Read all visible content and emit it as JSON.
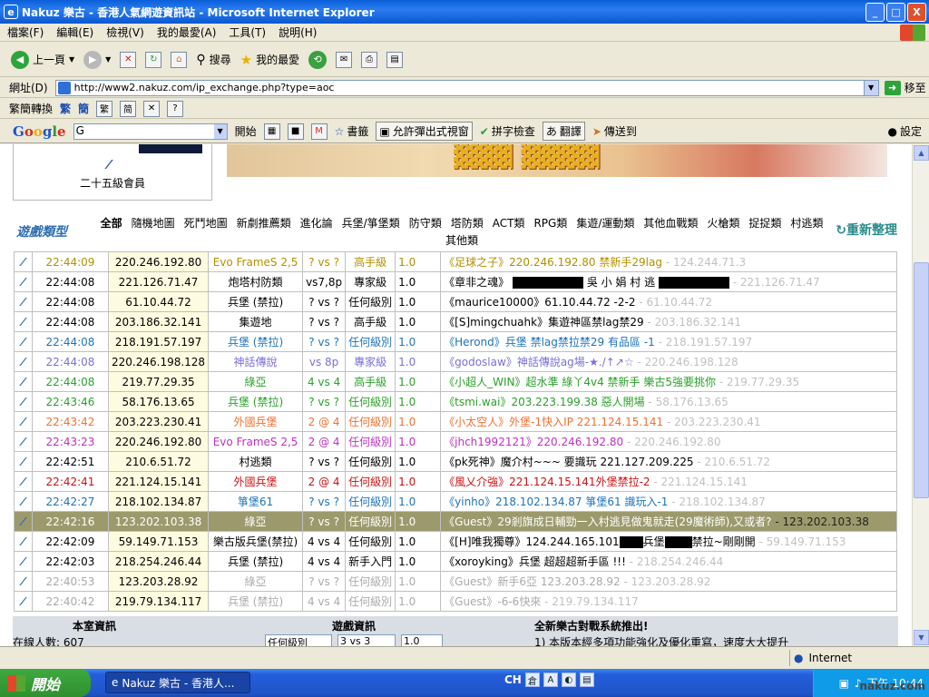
{
  "window": {
    "title": "Nakuz 樂古 - 香港人氣網遊資訊站 - Microsoft Internet Explorer",
    "buttons": [
      "_",
      "□",
      "X"
    ]
  },
  "menu": [
    "檔案(F)",
    "編輯(E)",
    "檢視(V)",
    "我的最愛(A)",
    "工具(T)",
    "說明(H)"
  ],
  "toolbar": {
    "back": "上一頁",
    "search": "搜尋",
    "favorites": "我的最愛"
  },
  "address": {
    "label": "網址(D)",
    "url": "http://www2.nakuz.com/ip_exchange.php?type=aoc",
    "go": "移至"
  },
  "convbar": {
    "label": "繁簡轉換",
    "trad": "繁",
    "simp": "簡"
  },
  "googlebar": {
    "logo": [
      "G",
      "o",
      "o",
      "g",
      "l",
      "e"
    ],
    "query": "G",
    "start": "開始",
    "bookmarks": "書籤",
    "popup": "允許彈出式視窗",
    "spell": "拼字檢查",
    "translate": "翻譯",
    "send": "傳送到",
    "settings": "設定"
  },
  "member": {
    "name": "二十五級會員"
  },
  "categories": {
    "label": "遊戲類型",
    "links": [
      "全部",
      "隨機地圖",
      "死鬥地圖",
      "新劇推薦類",
      "進化論",
      "兵堡/箏堡類",
      "防守類",
      "塔防類",
      "ACT類",
      "RPG類",
      "集遊/運動類",
      "其他血戰類",
      "火槍類",
      "捉捉類",
      "村逃類",
      "其他類"
    ],
    "reset": "重新整理"
  },
  "rows": [
    {
      "time": "22:44:09",
      "ip": "220.246.192.80",
      "game": "Evo FrameS 2,5",
      "mode": "? vs ?",
      "level": "高手級",
      "ver": "1.0",
      "msg": "《足球之子》220.246.192.80 禁新手29lag",
      "ipx": "- 124.244.71.3",
      "color": "#b09000",
      "style": "normal"
    },
    {
      "time": "22:44:08",
      "ip": "221.126.71.47",
      "game": "炮塔村防類",
      "mode": "vs7,8p",
      "level": "專家級",
      "ver": "1.0",
      "msg": "《章非之魂》",
      "msg2": "吳 小 娟 村 逃",
      "ipx": "- 221.126.71.47",
      "color": "#000000",
      "style": "blk"
    },
    {
      "time": "22:44:08",
      "ip": "61.10.44.72",
      "game": "兵堡 (禁拉)",
      "mode": "? vs ?",
      "level": "任何級別",
      "ver": "1.0",
      "msg": "《maurice10000》61.10.44.72 -2-2",
      "ipx": "- 61.10.44.72",
      "color": "#000000",
      "style": "normal"
    },
    {
      "time": "22:44:08",
      "ip": "203.186.32.141",
      "game": "集遊地",
      "mode": "? vs ?",
      "level": "高手級",
      "ver": "1.0",
      "msg": "《[S]mingchuahk》集遊神區禁lag禁29",
      "ipx": "- 203.186.32.141",
      "color": "#000000",
      "style": "normal"
    },
    {
      "time": "22:44:08",
      "ip": "218.191.57.197",
      "game": "兵堡 (禁拉)",
      "mode": "? vs ?",
      "level": "任何級別",
      "ver": "1.0",
      "msg": "《Herond》兵堡 禁lag禁拉禁29 有品區 -1",
      "ipx": "- 218.191.57.197",
      "color": "#1e72b8",
      "style": "normal"
    },
    {
      "time": "22:44:08",
      "ip": "220.246.198.128",
      "game": "神話傳說",
      "mode": "vs 8p",
      "level": "專家級",
      "ver": "1.0",
      "msg": "《godoslaw》神話傳說ag場-★./↑↗☆",
      "ipx": "- 220.246.198.128",
      "color": "#7a70d8",
      "style": "normal"
    },
    {
      "time": "22:44:08",
      "ip": "219.77.29.35",
      "game": "綠亞",
      "mode": "4 vs 4",
      "level": "高手級",
      "ver": "1.0",
      "msg": "《小超人_WIN》超水準 綠丫4v4 禁新手 樂古5強要挑你",
      "ipx": "- 219.77.29.35",
      "color": "#2aa02a",
      "style": "normal"
    },
    {
      "time": "22:43:46",
      "ip": "58.176.13.65",
      "game": "兵堡 (禁拉)",
      "mode": "? vs ?",
      "level": "任何級別",
      "ver": "1.0",
      "msg": "《tsmi.wai》203.223.199.38 惡人開場",
      "ipx": "- 58.176.13.65",
      "color": "#2aa02a",
      "style": "normal"
    },
    {
      "time": "22:43:42",
      "ip": "203.223.230.41",
      "game": "外國兵堡",
      "mode": "2 @ 4",
      "level": "任何級別",
      "ver": "1.0",
      "msg": "《小太空人》外堡-1快入IP 221.124.15.141",
      "ipx": "- 203.223.230.41",
      "color": "#f07030",
      "style": "normal"
    },
    {
      "time": "22:43:23",
      "ip": "220.246.192.80",
      "game": "Evo FrameS 2,5",
      "mode": "2 @ 4",
      "level": "任何級別",
      "ver": "1.0",
      "msg": "《jhch1992121》220.246.192.80",
      "ipx": "- 220.246.192.80",
      "color": "#c030c0",
      "style": "normal"
    },
    {
      "time": "22:42:51",
      "ip": "210.6.51.72",
      "game": "村逃類",
      "mode": "? vs ?",
      "level": "任何級別",
      "ver": "1.0",
      "msg": "《pk死神》魔介村~~~ 要識玩 221.127.209.225",
      "ipx": "- 210.6.51.72",
      "color": "#000000",
      "style": "normal"
    },
    {
      "time": "22:42:41",
      "ip": "221.124.15.141",
      "game": "外國兵堡",
      "mode": "2 @ 4",
      "level": "任何級別",
      "ver": "1.0",
      "msg": "《風乂介強》221.124.15.141外堡禁拉-2",
      "ipx": "- 221.124.15.141",
      "color": "#d01010",
      "style": "normal"
    },
    {
      "time": "22:42:27",
      "ip": "218.102.134.87",
      "game": "箏堡61",
      "mode": "? vs ?",
      "level": "任何級別",
      "ver": "1.0",
      "msg": "《yinho》218.102.134.87 箏堡61 識玩入-1",
      "ipx": "- 218.102.134.87",
      "color": "#1e72b8",
      "style": "normal"
    },
    {
      "time": "22:42:16",
      "ip": "123.202.103.38",
      "game": "綠亞",
      "mode": "? vs ?",
      "level": "任何級別",
      "ver": "1.0",
      "msg": "《Guest》29剎旗成日輔勁一入村逃見做鬼就走(29魔術師),又或者?",
      "ipx": "- 123.202.103.38",
      "color": "#ffffff",
      "style": "sel"
    },
    {
      "time": "22:42:09",
      "ip": "59.149.71.153",
      "game": "樂古版兵堡(禁拉)",
      "mode": "4 vs 4",
      "level": "任何級別",
      "ver": "1.0",
      "msg": "《[H]唯我獨尊》124.244.165.101",
      "msg2": "兵堡",
      "msg3": "禁拉~剛剛開",
      "ipx": "- 59.149.71.153",
      "color": "#000000",
      "style": "blk2"
    },
    {
      "time": "22:42:03",
      "ip": "218.254.246.44",
      "game": "兵堡 (禁拉)",
      "mode": "4 vs 4",
      "level": "新手入門",
      "ver": "1.0",
      "msg": "《xoroyking》兵堡 超超超新手區 !!!",
      "ipx": "- 218.254.246.44",
      "color": "#000000",
      "style": "normal"
    },
    {
      "time": "22:40:53",
      "ip": "123.203.28.92",
      "game": "綠亞",
      "mode": "? vs ?",
      "level": "任何級別",
      "ver": "1.0",
      "msg": "《Guest》新手6亞 123.203.28.92",
      "ipx": "- 123.203.28.92",
      "color": "#aaaaaa",
      "style": "normal"
    },
    {
      "time": "22:40:42",
      "ip": "219.79.134.117",
      "game": "兵堡 (禁拉)",
      "mode": "4 vs 4",
      "level": "任何級別",
      "ver": "1.0",
      "msg": "《Guest》-6-6快來",
      "ipx": "- 219.79.134.117",
      "color": "#aaaaaa",
      "style": "normal"
    }
  ],
  "footer": {
    "room": "本室資訊",
    "online": "在線人數: 607",
    "game": "遊戲資訊",
    "sel1": "任何級別",
    "sel2": "3 vs 3",
    "sel3": "1.0",
    "news": "全新樂古對戰系統推出!",
    "news2": "1) 本版本經多項功能強化及優化重寫，速度大大提升"
  },
  "status": {
    "zone": "Internet"
  },
  "taskbar": {
    "start": "開始",
    "task": "Nakuz 樂古 - 香港人...",
    "lang": "CH",
    "clock": "下午 10:44"
  },
  "watermark": "nakuz.com"
}
